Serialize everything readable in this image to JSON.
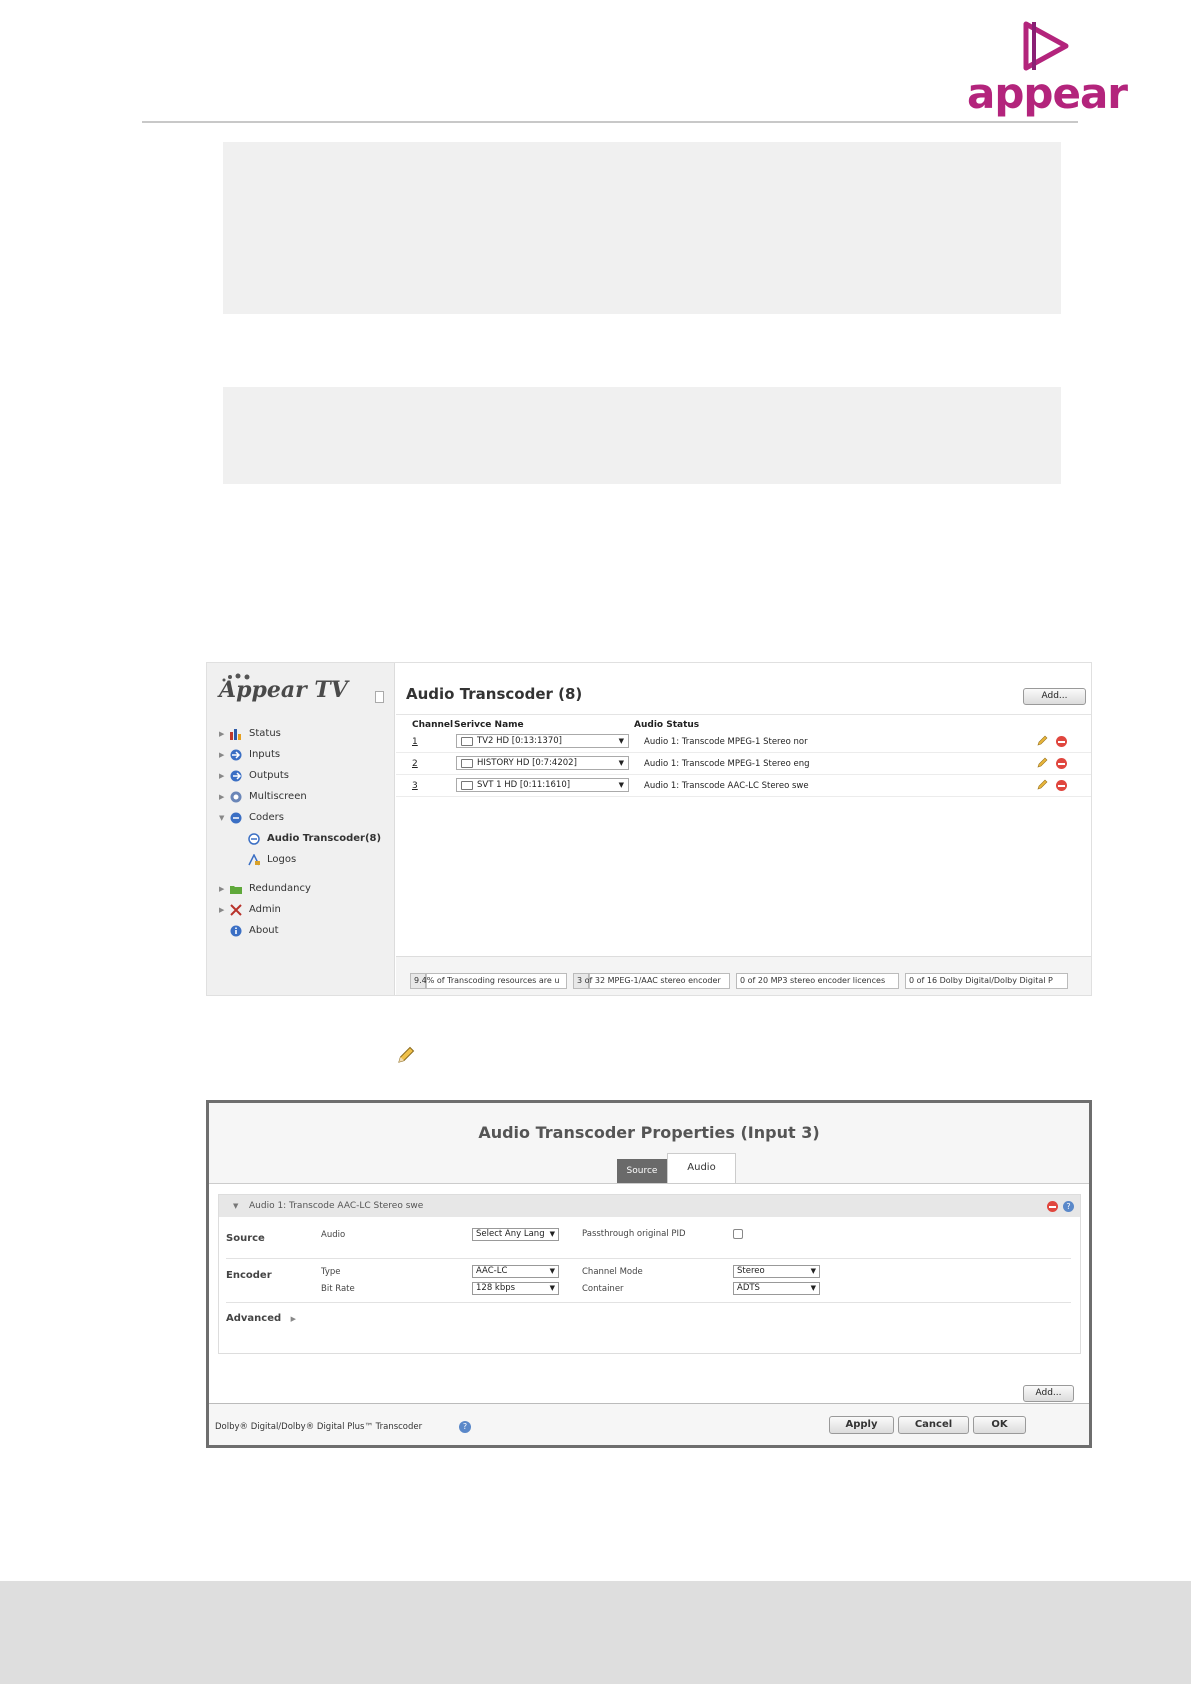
{
  "header": {
    "logo_text": "appear",
    "brand_color": "#b3247c"
  },
  "ui1": {
    "brand": "Appear TV",
    "nav": [
      {
        "label": "Status",
        "icon": "bar-chart-icon"
      },
      {
        "label": "Inputs",
        "icon": "input-arrow-icon"
      },
      {
        "label": "Outputs",
        "icon": "output-arrow-icon"
      },
      {
        "label": "Multiscreen",
        "icon": "multiscreen-icon"
      },
      {
        "label": "Coders",
        "icon": "coders-icon"
      },
      {
        "label": "Audio Transcoder(8)",
        "icon": "audio-transcoder-icon"
      },
      {
        "label": "Logos",
        "icon": "logos-icon"
      },
      {
        "label": "Redundancy",
        "icon": "folder-icon"
      },
      {
        "label": "Admin",
        "icon": "tools-icon"
      },
      {
        "label": "About",
        "icon": "info-icon"
      }
    ],
    "title": "Audio Transcoder (8)",
    "add_button": "Add...",
    "columns": {
      "channel": "Channel",
      "service": "Serivce Name",
      "status": "Audio Status"
    },
    "rows": [
      {
        "channel": "1",
        "service": "TV2 HD [0:13:1370]",
        "status": "Audio 1: Transcode MPEG-1 Stereo nor"
      },
      {
        "channel": "2",
        "service": "HISTORY HD [0:7:4202]",
        "status": "Audio 1: Transcode MPEG-1 Stereo eng"
      },
      {
        "channel": "3",
        "service": "SVT 1 HD [0:11:1610]",
        "status": "Audio 1: Transcode AAC-LC Stereo swe"
      }
    ],
    "footer_bars": [
      {
        "text": "9.4% of Transcoding resources are u",
        "fill": 0.094
      },
      {
        "text": "3 of 32 MPEG-1/AAC stereo encoder",
        "fill": 0.094
      },
      {
        "text": "0 of 20 MP3 stereo encoder licences",
        "fill": 0
      },
      {
        "text": "0 of 16 Dolby Digital/Dolby Digital P",
        "fill": 0
      }
    ]
  },
  "ui2": {
    "title": "Audio Transcoder Properties (Input 3)",
    "tabs": {
      "source": "Source",
      "audio": "Audio"
    },
    "panel_title": "Audio 1: Transcode AAC-LC Stereo swe",
    "source": {
      "section": "Source",
      "audio_label": "Audio",
      "audio_value": "Select Any Lang",
      "passthrough_label": "Passthrough original PID",
      "passthrough_checked": false
    },
    "encoder": {
      "section": "Encoder",
      "type_label": "Type",
      "type_value": "AAC-LC",
      "bitrate_label": "Bit Rate",
      "bitrate_value": "128 kbps",
      "channel_mode_label": "Channel Mode",
      "channel_mode_value": "Stereo",
      "container_label": "Container",
      "container_value": "ADTS"
    },
    "advanced": "Advanced",
    "add_button": "Add...",
    "dolby_text": "Dolby® Digital/Dolby® Digital Plus™ Transcoder",
    "help_glyph": "?",
    "buttons": {
      "apply": "Apply",
      "cancel": "Cancel",
      "ok": "OK"
    }
  }
}
